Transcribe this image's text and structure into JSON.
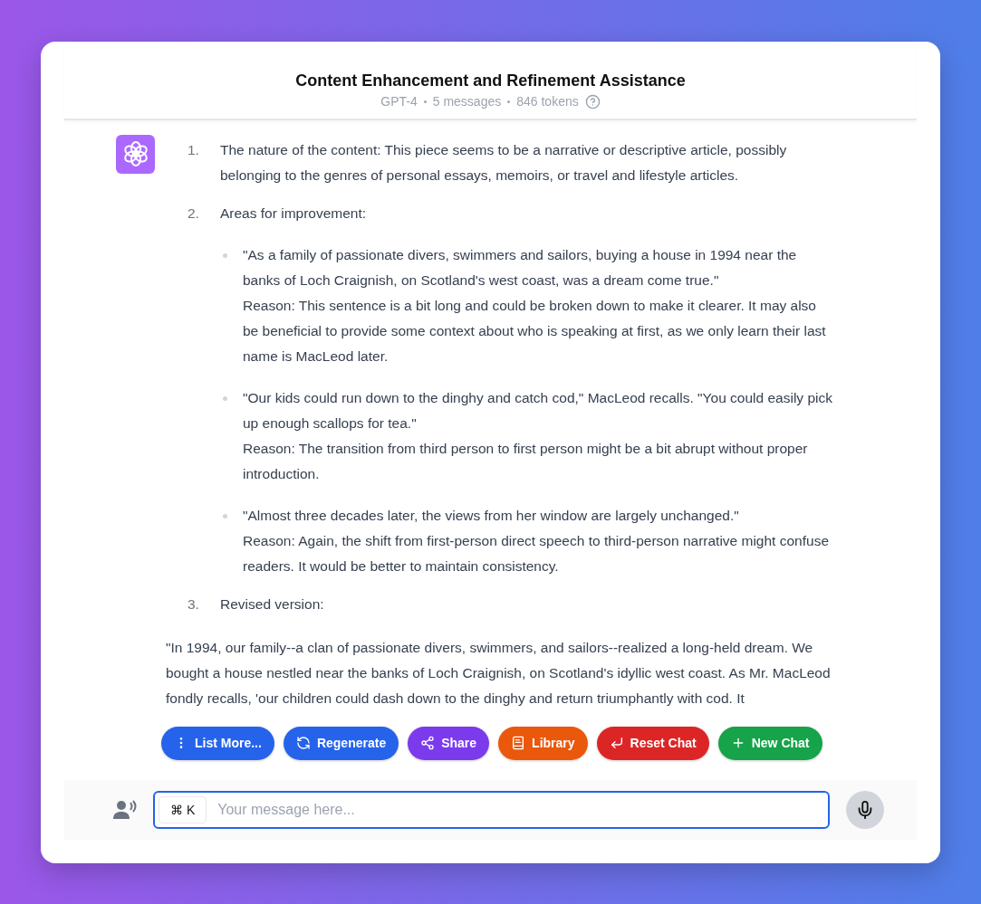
{
  "header": {
    "title": "Content Enhancement and Refinement Assistance",
    "meta": [
      "GPT-4",
      "5 messages",
      "846 tokens"
    ]
  },
  "message": {
    "items": [
      {
        "number": "1.",
        "text": "The nature of the content: This piece seems to be a narrative or descriptive article, possibly belonging to the genres of personal essays, memoirs, or travel and lifestyle articles."
      },
      {
        "number": "2.",
        "text": "Areas for improvement:",
        "bullets": [
          {
            "lines": [
              "\"As a family of passionate divers, swimmers and sailors, buying a house in 1994 near the banks of Loch Craignish, on Scotland's west coast, was a dream come true.\"",
              "Reason: This sentence is a bit long and could be broken down to make it clearer. It may also be beneficial to provide some context about who is speaking at first, as we only learn their last name is MacLeod later."
            ]
          },
          {
            "lines": [
              "\"Our kids could run down to the dinghy and catch cod,\" MacLeod recalls. \"You could easily pick up enough scallops for tea.\"",
              "Reason: The transition from third person to first person might be a bit abrupt without proper introduction."
            ]
          },
          {
            "lines": [
              "\"Almost three decades later, the views from her window are largely unchanged.\"",
              "Reason: Again, the shift from first-person direct speech to third-person narrative might confuse readers. It would be better to maintain consistency."
            ]
          }
        ]
      },
      {
        "number": "3.",
        "text": "Revised version:"
      }
    ],
    "paragraph": "\"In 1994, our family--a clan of passionate divers, swimmers, and sailors--realized a long-held dream. We bought a house nestled near the banks of Loch Craignish, on Scotland's idyllic west coast. As Mr. MacLeod fondly recalls, 'our children could dash down to the dinghy and return triumphantly with cod. It"
  },
  "actions": [
    {
      "label": "List More...",
      "kind": "dots",
      "color": "#2563eb"
    },
    {
      "label": "Regenerate",
      "kind": "refresh",
      "color": "#2563eb"
    },
    {
      "label": "Share",
      "kind": "share",
      "color": "#7c3aed"
    },
    {
      "label": "Library",
      "kind": "book",
      "color": "#ea580c"
    },
    {
      "label": "Reset Chat",
      "kind": "reset",
      "color": "#dc2626"
    },
    {
      "label": "New Chat",
      "kind": "plus",
      "color": "#16a34a"
    }
  ],
  "input": {
    "shortcut": "⌘ K",
    "placeholder": "Your message here..."
  }
}
